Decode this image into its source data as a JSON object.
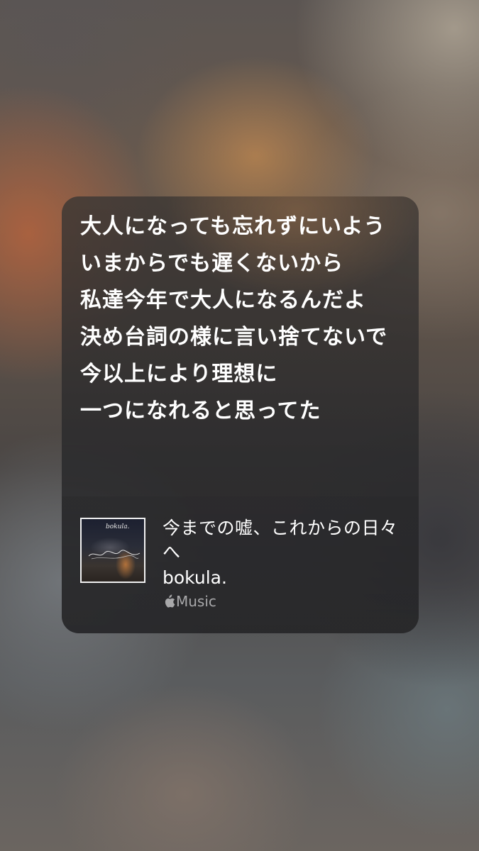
{
  "lyrics": {
    "lines": [
      "大人になっても忘れずにいよう",
      "いまからでも遅くないから",
      "私達今年で大人になるんだよ",
      "決め台詞の様に言い捨てないで",
      "今以上により理想に",
      "一つになれると思ってた"
    ]
  },
  "track": {
    "title": "今までの嘘、これからの日々へ",
    "artist": "bokula.",
    "service_label": "Music",
    "service_icon": "apple-icon",
    "artwork_text": "bokula."
  },
  "colors": {
    "text": "#ffffff",
    "service": "#a8a8aa"
  }
}
